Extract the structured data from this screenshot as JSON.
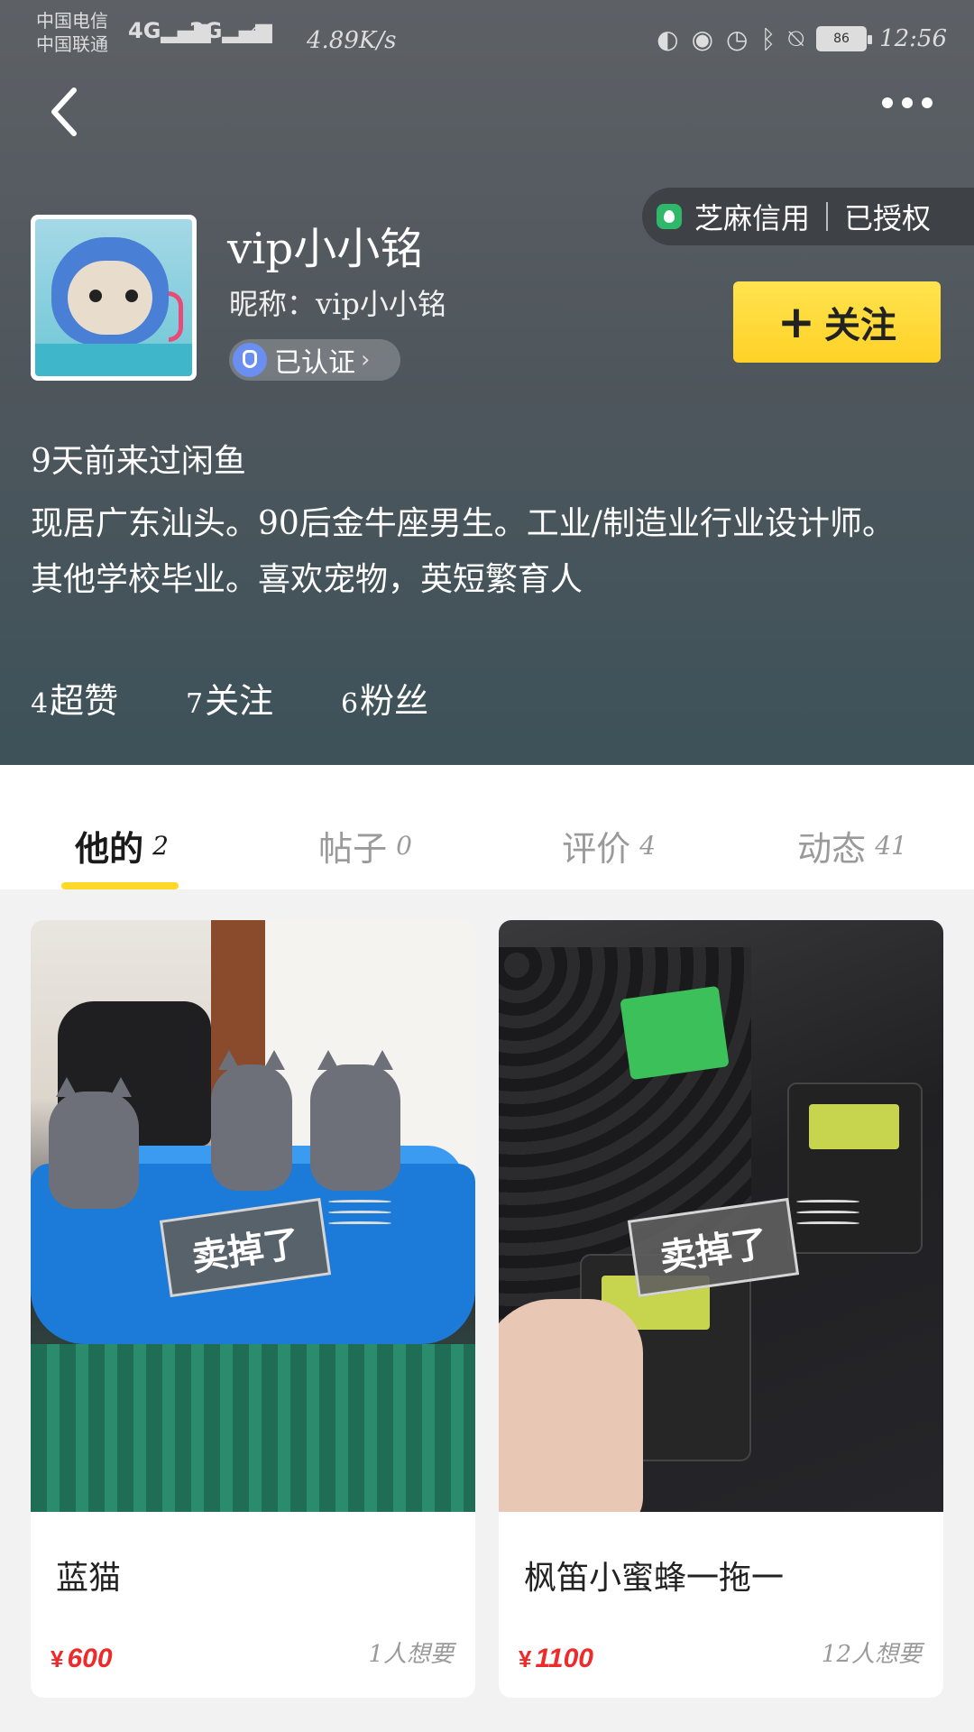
{
  "status_bar": {
    "carrier1": "中国电信",
    "carrier2": "中国联通",
    "net1": "4G",
    "net2": "2G",
    "speed": "4.89K/s",
    "battery": "86",
    "time": "12:56"
  },
  "profile": {
    "name": "vip小小铭",
    "nickname_label": "昵称：",
    "nickname": "vip小小铭",
    "verified": "已认证",
    "follow_label": "关注",
    "sesame_label": "芝麻信用",
    "sesame_status": "已授权",
    "last_visit": "9天前来过闲鱼",
    "bio": "现居广东汕头。90后金牛座男生。工业/制造业行业设计师。其他学校毕业。喜欢宠物，英短繁育人"
  },
  "stats": [
    {
      "count": "4",
      "label": "超赞"
    },
    {
      "count": "7",
      "label": "关注"
    },
    {
      "count": "6",
      "label": "粉丝"
    }
  ],
  "tabs": [
    {
      "label": "他的",
      "count": "2"
    },
    {
      "label": "帖子",
      "count": "0"
    },
    {
      "label": "评价",
      "count": "4"
    },
    {
      "label": "动态",
      "count": "41"
    }
  ],
  "items": [
    {
      "title": "蓝猫",
      "price_symbol": "¥",
      "price": "600",
      "want": "1人想要",
      "badge": "卖掉了"
    },
    {
      "title": "枫笛小蜜蜂一拖一",
      "price_symbol": "¥",
      "price": "1100",
      "want": "12人想要",
      "badge": "卖掉了"
    }
  ],
  "colors": {
    "accent": "#ffd829",
    "price": "#ee2a2a"
  }
}
